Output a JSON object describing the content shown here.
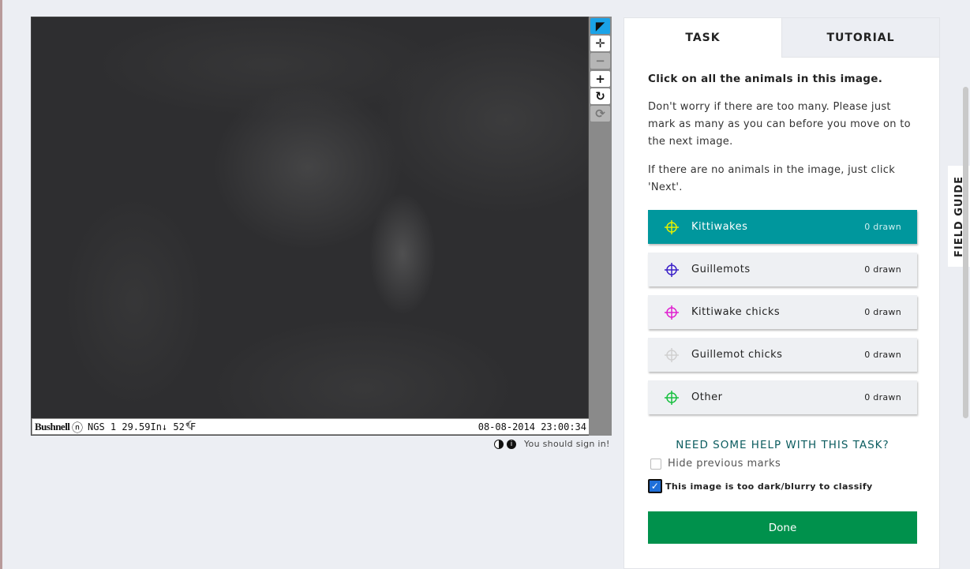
{
  "viewer": {
    "camera": {
      "brand": "Bushnell",
      "meta": "NGS 1 29.59In↓ 52°F",
      "timestamp": "08-08-2014 23:00:34"
    },
    "tools": [
      {
        "name": "pointer-tool",
        "icon": "pointer-icon",
        "glyph": "◤",
        "state": "active"
      },
      {
        "name": "pan-tool",
        "icon": "move-icon",
        "glyph": "✛",
        "state": "normal"
      },
      {
        "name": "zoom-out-tool",
        "icon": "minus-icon",
        "glyph": "−",
        "state": "disabled"
      },
      {
        "name": "zoom-in-tool",
        "icon": "plus-icon",
        "glyph": "+",
        "state": "normal"
      },
      {
        "name": "rotate-tool",
        "icon": "rotate-icon",
        "glyph": "↻",
        "state": "normal"
      },
      {
        "name": "reset-tool",
        "icon": "refresh-icon",
        "glyph": "⟳",
        "state": "disabled"
      }
    ],
    "signin_text": "You should sign in!"
  },
  "tabs": {
    "task": "TASK",
    "tutorial": "TUTORIAL"
  },
  "task": {
    "question": "Click on all the animals in this image.",
    "instructions_1": "Don't worry if there are too many. Please just mark as many as you can before you move on to the next image.",
    "instructions_2": "If there are no animals in the image, just click 'Next'.",
    "choices": [
      {
        "label": "Kittiwakes",
        "count": "0 drawn",
        "color": "#e6f000",
        "selected": true
      },
      {
        "label": "Guillemots",
        "count": "0 drawn",
        "color": "#3a20c8",
        "selected": false
      },
      {
        "label": "Kittiwake chicks",
        "count": "0 drawn",
        "color": "#e020d0",
        "selected": false
      },
      {
        "label": "Guillemot chicks",
        "count": "0 drawn",
        "color": "#d0d0d0",
        "selected": false
      },
      {
        "label": "Other",
        "count": "0 drawn",
        "color": "#18c040",
        "selected": false
      }
    ],
    "help_link": "NEED SOME HELP WITH THIS TASK?",
    "hide_marks_label": "Hide previous marks",
    "hide_marks_checked": false,
    "too_dark_label": "This image is too dark/blurry to classify",
    "too_dark_checked": true,
    "done_label": "Done"
  },
  "field_guide_label": "FIELD GUIDE",
  "colors": {
    "accent": "#00979d",
    "done": "#00914c",
    "active_tool": "#1aa3e8"
  }
}
